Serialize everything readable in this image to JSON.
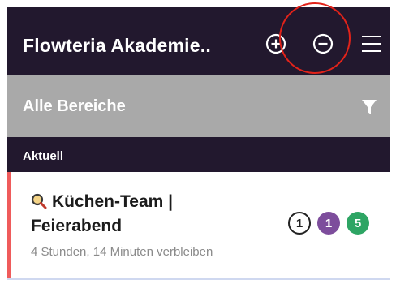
{
  "appbar": {
    "title": "Flowteria Akademie..",
    "add_icon": "plus-circle-icon",
    "remove_icon": "minus-circle-icon",
    "menu_icon": "hamburger-menu-icon",
    "background": "#22182e"
  },
  "filterbar": {
    "title": "Alle Bereiche",
    "filter_icon": "filter-funnel-icon",
    "background": "#a9a9a9"
  },
  "section": {
    "title": "Aktuell"
  },
  "items": [
    {
      "emoji_icon": "magnifying-glass-icon",
      "title": "Küchen-Team | Feierabend",
      "subtitle": "4 Stunden, 14 Minuten verbleiben",
      "accent_color": "#ef5b5b",
      "badges": [
        {
          "value": "1",
          "style": "outline",
          "color": "#222222"
        },
        {
          "value": "1",
          "style": "filled",
          "color": "#7d4d9c"
        },
        {
          "value": "5",
          "style": "filled",
          "color": "#2ea564"
        }
      ]
    }
  ],
  "annotation": {
    "highlight_color": "#e2231a"
  }
}
